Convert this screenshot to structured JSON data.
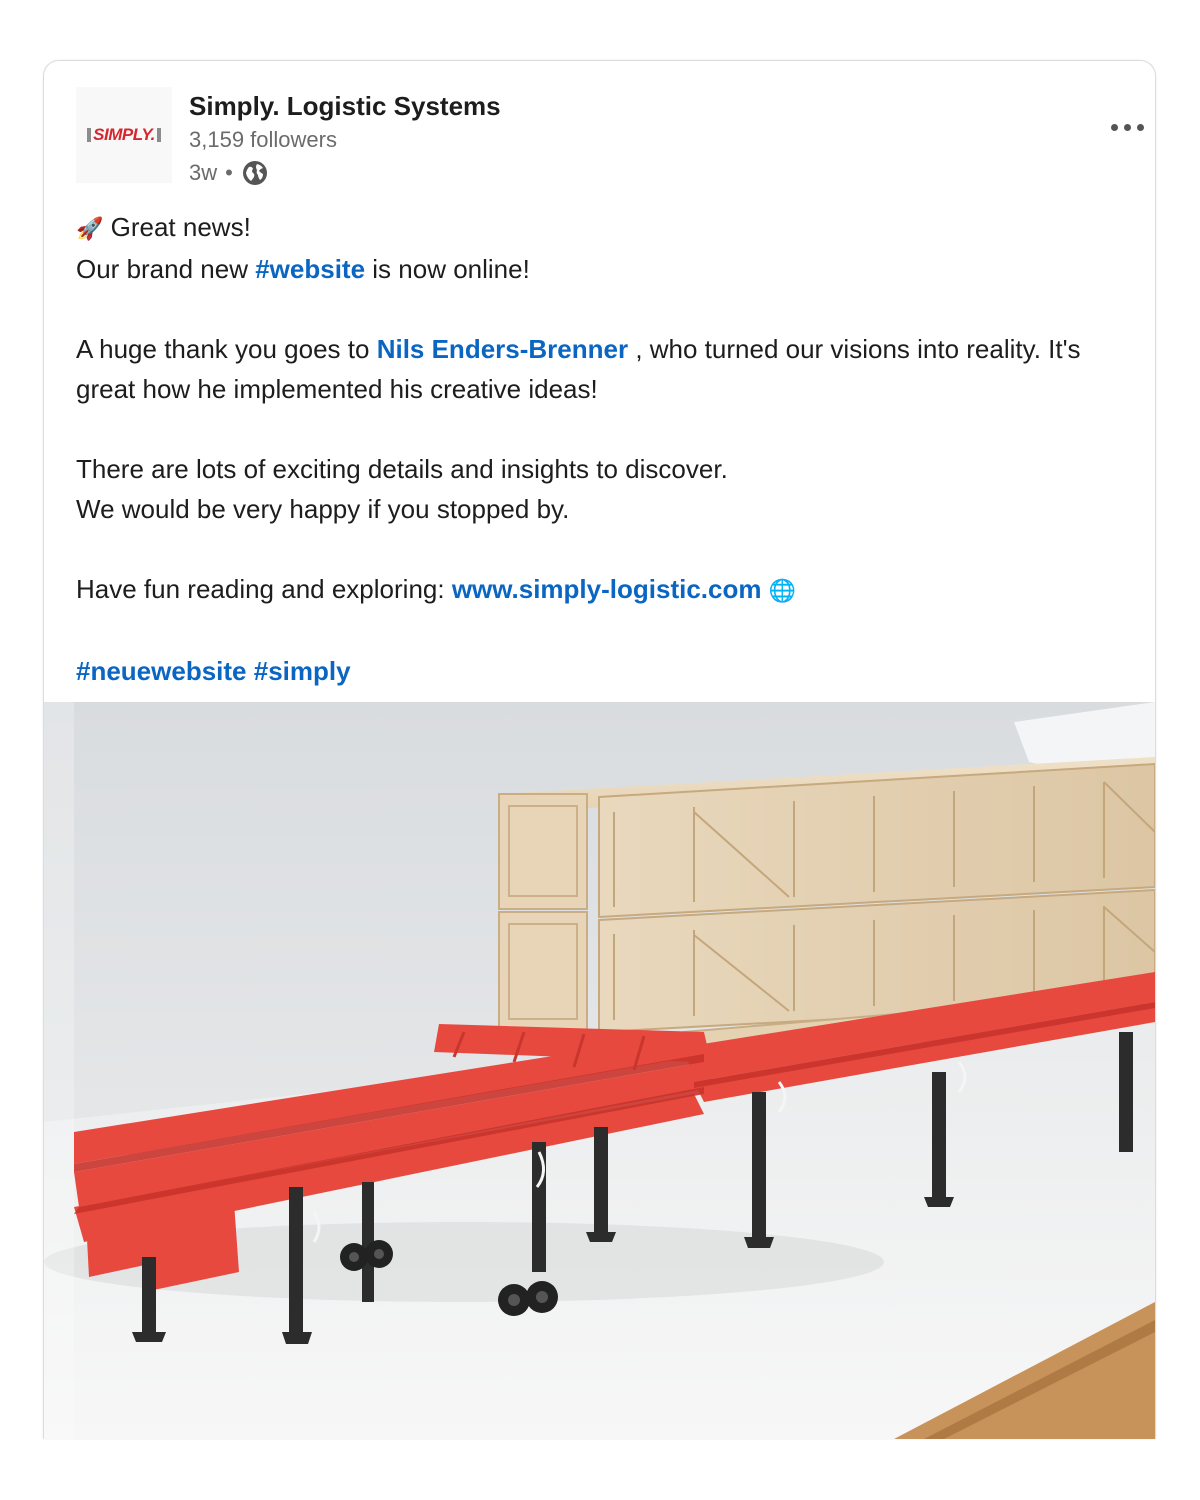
{
  "post": {
    "author": {
      "name": "Simply. Logistic Systems",
      "logo_text": "SIMPLY.",
      "followers": "3,159 followers",
      "time": "3w",
      "separator": "•",
      "visibility_icon": "globe-icon"
    },
    "menu_icon": "more-horizontal-icon",
    "body": {
      "line1_emoji": "🚀",
      "line1_text": " Great news!",
      "line2_prefix": "Our brand new ",
      "line2_hashtag": "#website",
      "line2_suffix": " is now online!",
      "line3_prefix": "A huge thank you goes to ",
      "line3_mention": "Nils Enders-Brenner",
      "line3_suffix": " , who turned our visions into reality. It's great how he implemented his creative ideas!",
      "line4": "There are lots of exciting details and insights to discover.",
      "line5": "We would be very happy if you stopped by.",
      "line6_prefix": "Have fun reading and exploring: ",
      "line6_link": "www.simply-logistic.com",
      "line6_emoji": "🌐",
      "hashtag1": "#neuewebsite",
      "hashtag2": "#simply"
    },
    "image": {
      "description_icon": "photo",
      "colors": {
        "frame": "#e8493f",
        "crate": "#e3d0b4",
        "legs": "#2e2e2e",
        "background": "#dfe1e3",
        "floor": "#f2f2f2",
        "table": "#c8935a"
      }
    }
  }
}
